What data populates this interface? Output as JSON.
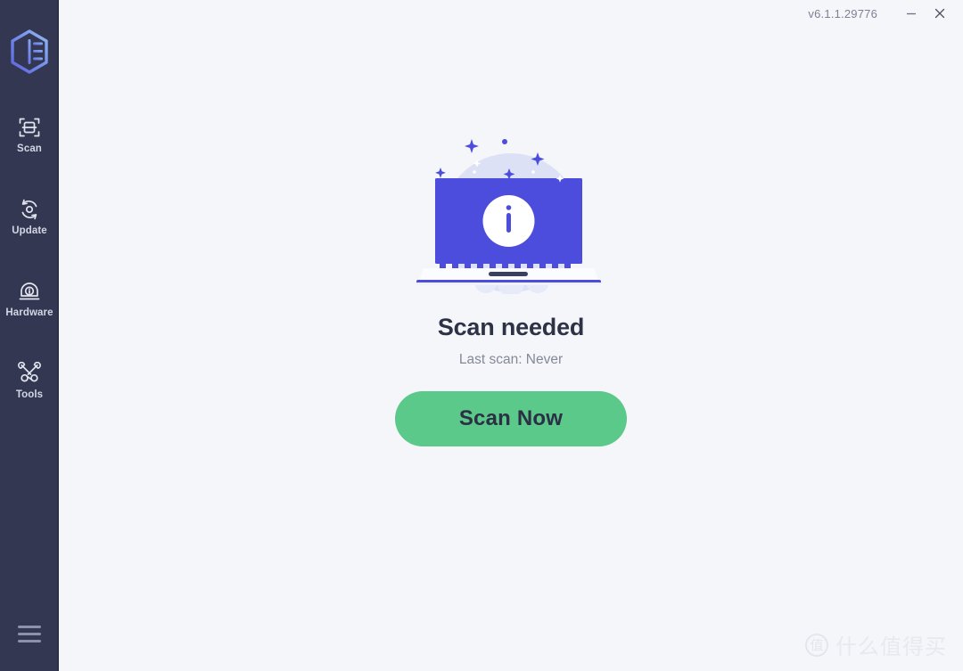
{
  "window": {
    "version": "v6.1.1.29776",
    "minimize_label": "Minimize",
    "close_label": "Close"
  },
  "sidebar": {
    "logo_name": "app-logo",
    "items": [
      {
        "label": "Scan",
        "icon": "scan-icon"
      },
      {
        "label": "Update",
        "icon": "update-icon"
      },
      {
        "label": "Hardware",
        "icon": "hardware-icon"
      },
      {
        "label": "Tools",
        "icon": "tools-icon"
      }
    ],
    "menu_label": "Menu"
  },
  "main": {
    "illustration_name": "laptop-info-illustration",
    "status_title": "Scan needed",
    "status_subtitle": "Last scan: Never",
    "scan_button_label": "Scan Now"
  },
  "watermark": {
    "badge": "值",
    "text": "什么值得买"
  },
  "colors": {
    "sidebar_bg": "#333751",
    "page_bg": "#f5f6fa",
    "accent_blue": "#4c4ddc",
    "accent_green": "#5bc98a",
    "title_text": "#2e3247",
    "sub_text": "#848899",
    "nav_label": "#d3d6e4",
    "illustration_circle": "#dde1f5"
  }
}
